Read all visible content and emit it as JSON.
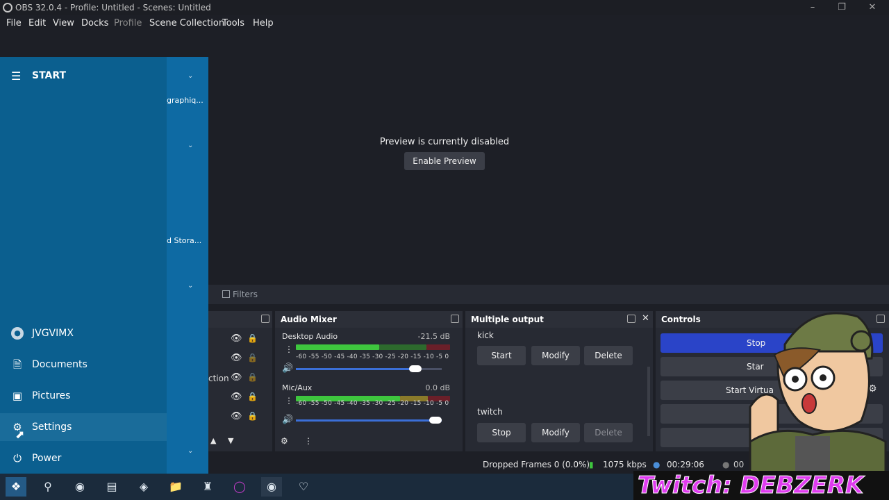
{
  "window": {
    "title": "OBS 32.0.4 - Profile: Untitled - Scenes: Untitled"
  },
  "menu": [
    "File",
    "Edit",
    "View",
    "Docks",
    "Profile",
    "Scene Collection",
    "Tools",
    "Help"
  ],
  "preview": {
    "message": "Preview is currently disabled",
    "button": "Enable Preview"
  },
  "filters_label": "Filters",
  "sources": {
    "partial_label": "ction"
  },
  "audio_mixer": {
    "title": "Audio Mixer",
    "channels": [
      {
        "name": "Desktop Audio",
        "level": "-21.5 dB",
        "volume": 0.85
      },
      {
        "name": "Mic/Aux",
        "level": "0.0 dB",
        "volume": 1.0
      }
    ],
    "ticks": "-60 -55 -50 -45 -40 -35 -30 -25 -20 -15 -10 -5 0"
  },
  "multiple_output": {
    "title": "Multiple output",
    "targets": [
      {
        "name": "kick",
        "action": "Start",
        "modify": "Modify",
        "delete": "Delete"
      },
      {
        "name": "twitch",
        "action": "Stop",
        "modify": "Modify",
        "delete": "Delete"
      }
    ]
  },
  "controls": {
    "title": "Controls",
    "buttons": [
      "Stop",
      "Star",
      "Start Virtua"
    ]
  },
  "status": {
    "dropped": "Dropped Frames 0 (0.0%)",
    "bitrate": "1075 kbps",
    "time": "00:29:06",
    "time2": "00"
  },
  "start_menu": {
    "header": "START",
    "right_snippets": [
      "graphiq...",
      "d Stora..."
    ],
    "items": [
      "JVGVIMX",
      "Documents",
      "Pictures",
      "Settings",
      "Power"
    ]
  },
  "overlay": {
    "twitch": "Twitch: DEBZERK"
  },
  "colors": {
    "accent_blue": "#2a44c8",
    "start_bg": "#0b5f8f",
    "meter_green": "#3ec63e",
    "meter_yellow": "#c9a92c",
    "meter_red": "#c0283c"
  }
}
